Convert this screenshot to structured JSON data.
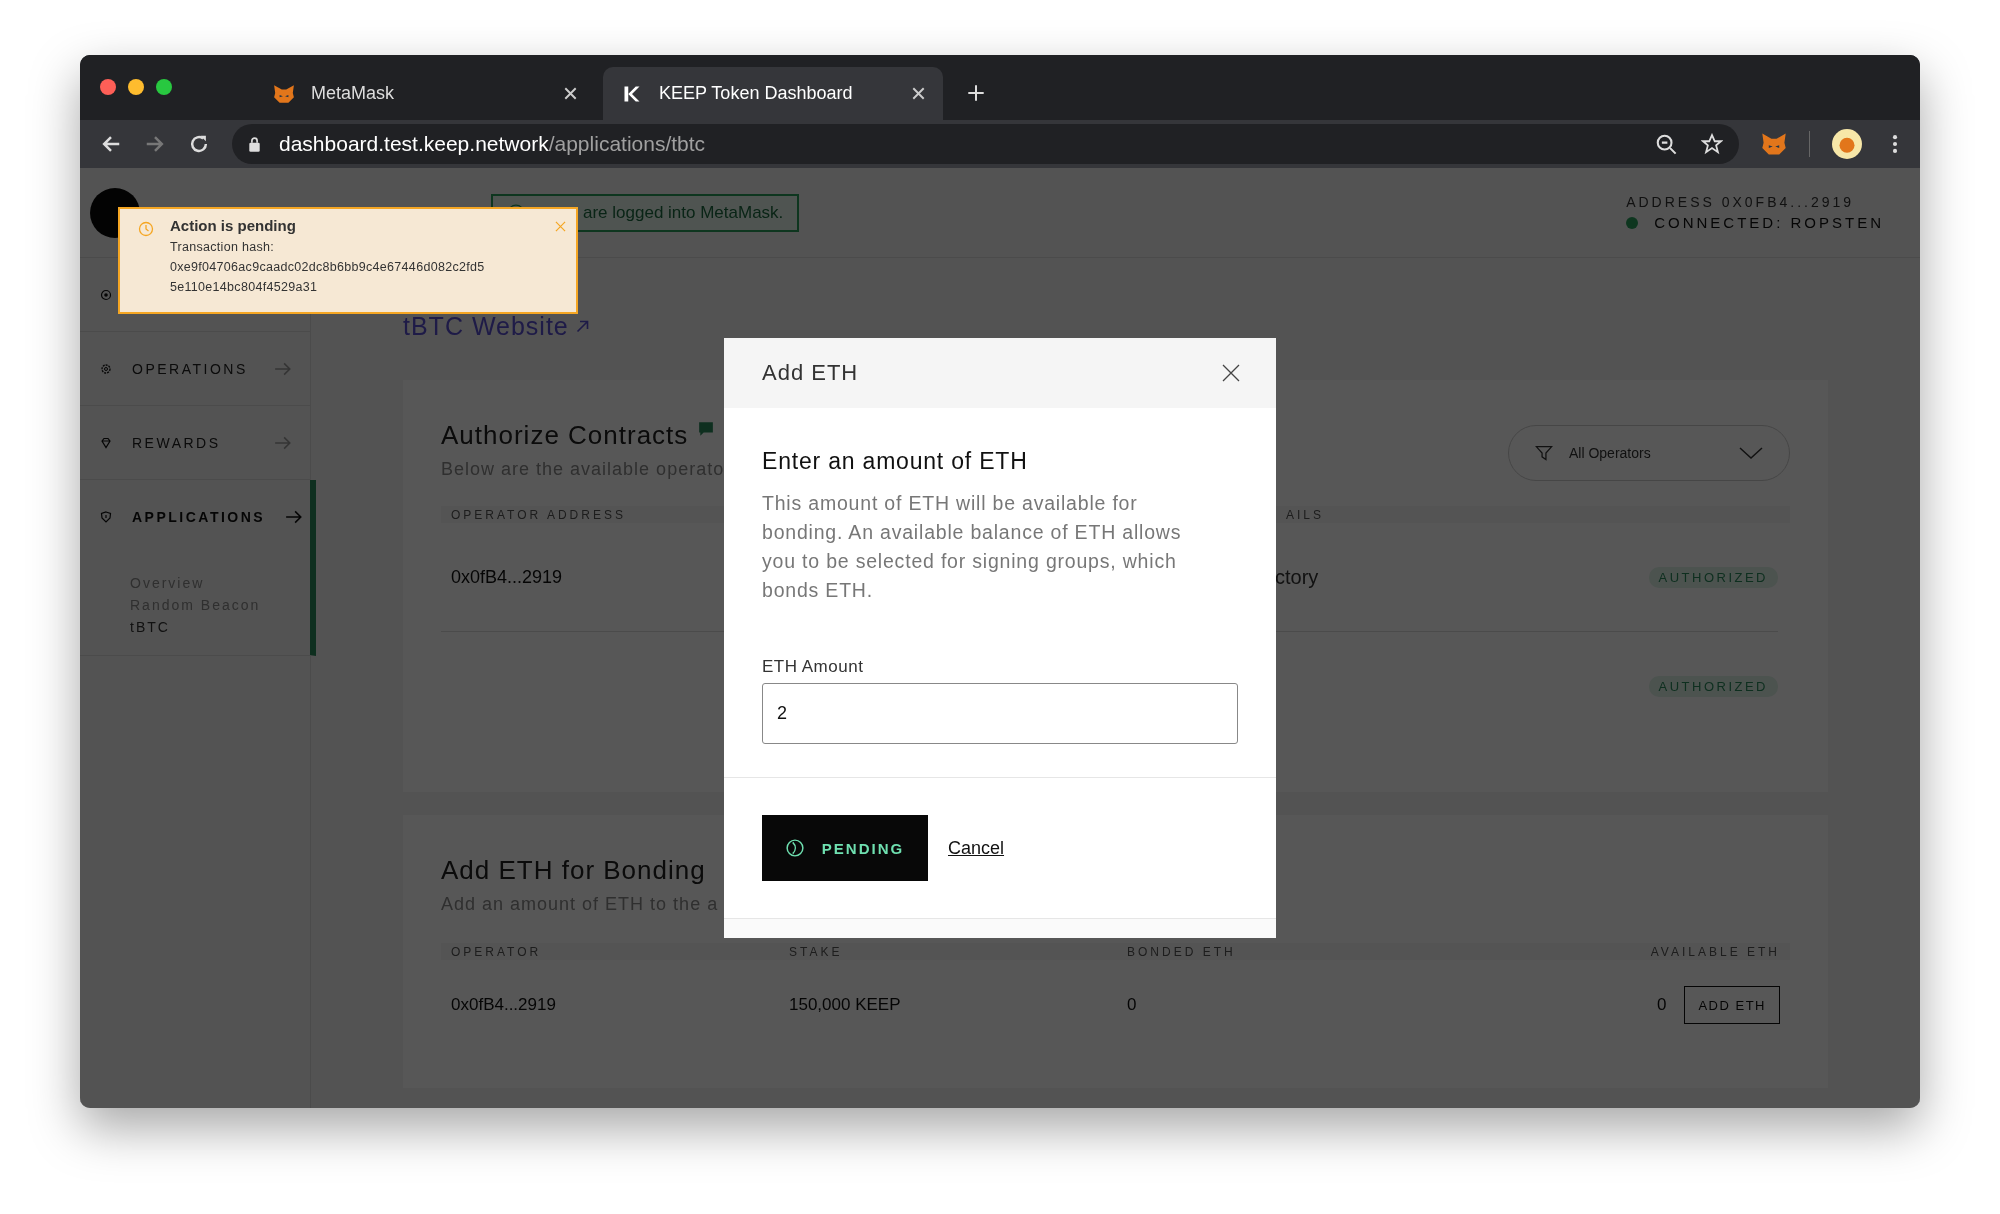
{
  "browser": {
    "tabs": [
      {
        "title": "MetaMask",
        "selected": false
      },
      {
        "title": "KEEP Token Dashboard",
        "selected": true
      }
    ],
    "url_host": "dashboard.test.keep.network",
    "url_path": "/applications/tbtc"
  },
  "header": {
    "banner": "are logged into MetaMask.",
    "address": "ADDRESS 0X0FB4...2919",
    "network": "CONNECTED: ROPSTEN",
    "connected": true
  },
  "sidebar": {
    "items": [
      {
        "label": "OPERATIONS",
        "selected": false
      },
      {
        "label": "REWARDS",
        "selected": false
      },
      {
        "label": "APPLICATIONS",
        "selected": true
      }
    ],
    "sub_items": [
      {
        "label": "Overview",
        "selected": false
      },
      {
        "label": "Random Beacon",
        "selected": false
      },
      {
        "label": "tBTC",
        "selected": true
      }
    ]
  },
  "website_link": "tBTC Website",
  "authorize_card": {
    "title": "Authorize Contracts",
    "subtitle": "Below are the available operato",
    "filter": "All Operators",
    "columns": [
      "OPERATOR ADDRESS",
      "AILS"
    ],
    "rows": [
      {
        "operator": "0x0fB4...2919",
        "contract": "ctory",
        "status": "AUTHORIZED"
      },
      {
        "status": "AUTHORIZED"
      }
    ]
  },
  "bonding_card": {
    "title": "Add ETH for Bonding",
    "subtitle": "Add an amount of ETH to the a",
    "columns": [
      "OPERATOR",
      "STAKE",
      "BONDED ETH",
      "AVAILABLE ETH"
    ],
    "rows": [
      {
        "operator": "0x0fB4...2919",
        "stake": "150,000 KEEP",
        "bonded": "0",
        "available": "0",
        "action": "ADD ETH"
      }
    ]
  },
  "modal": {
    "title": "Add ETH",
    "heading": "Enter an amount of ETH",
    "body": "This amount of ETH will be available for bonding. An available balance of ETH allows you to be selected for signing groups, which bonds ETH.",
    "field_label": "ETH Amount",
    "field_value": "2",
    "submit": "PENDING",
    "pending": true,
    "cancel": "Cancel"
  },
  "toast": {
    "title": "Action is pending",
    "label": "Transaction hash:",
    "hash_lines": [
      "0xe9f04706ac9caadc02dc8b6bb9c4e67446d082c2fd5",
      "5e110e14bc804f4529a31"
    ]
  }
}
